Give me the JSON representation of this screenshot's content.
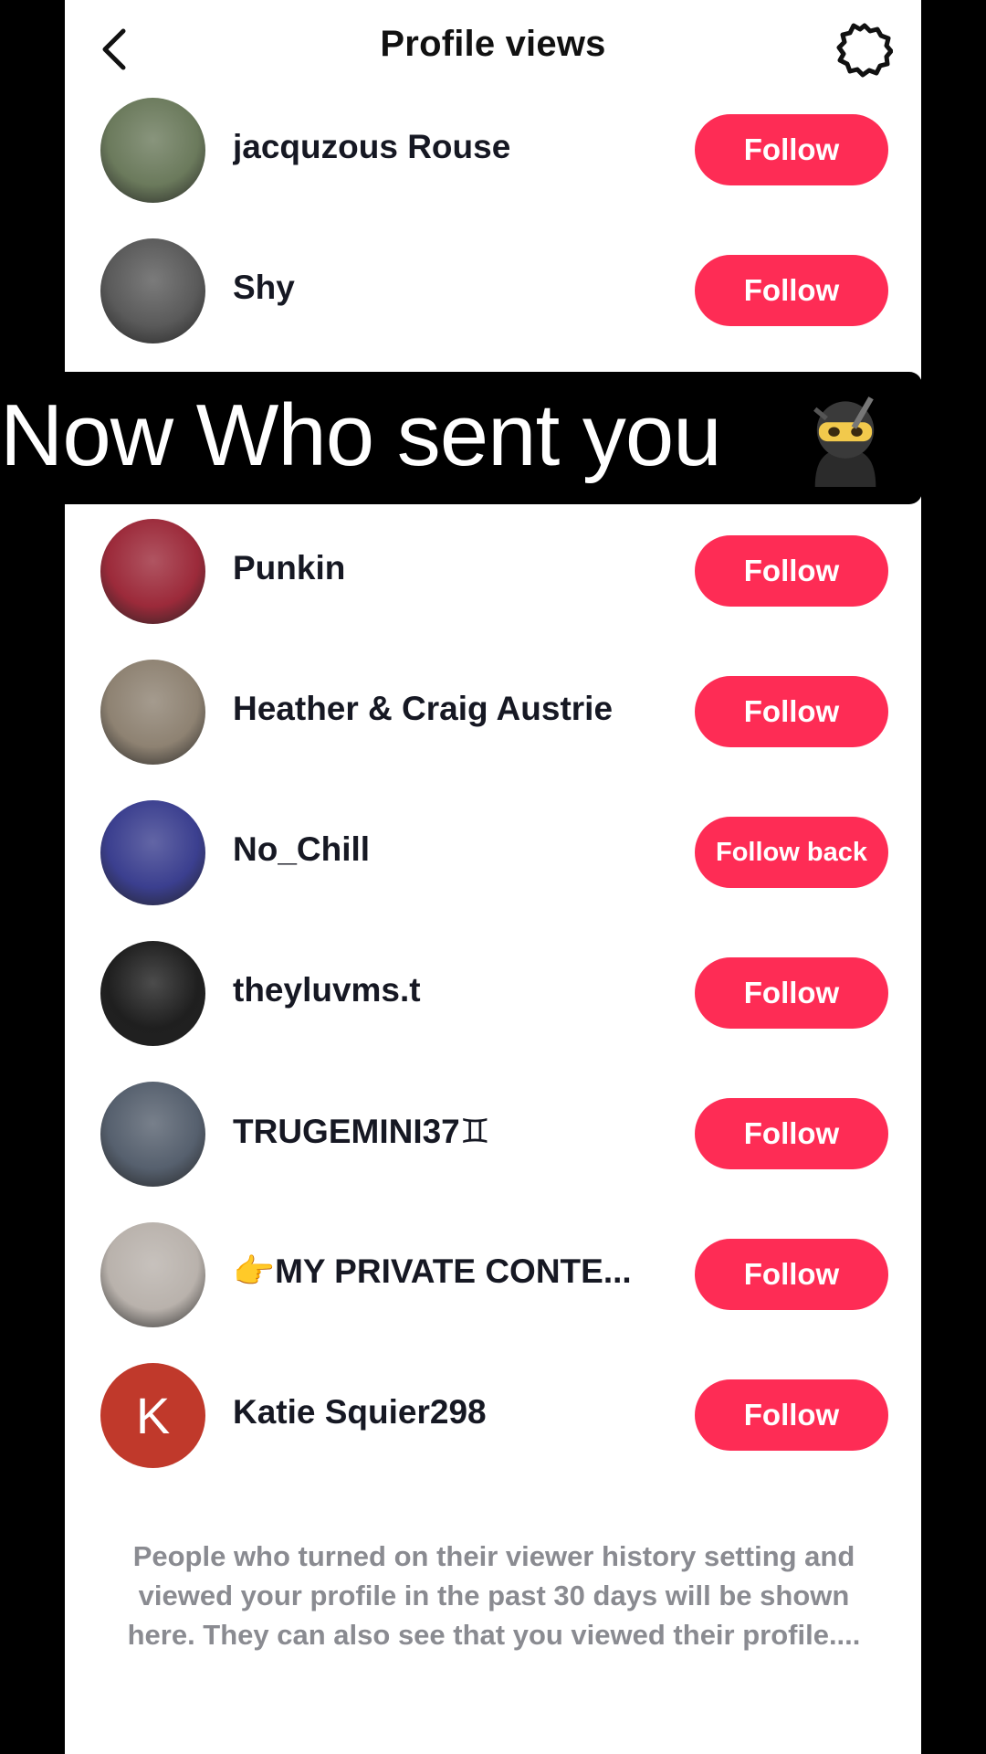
{
  "header": {
    "title": "Profile views",
    "back_icon": "chevron-left-icon",
    "settings_icon": "gear-icon"
  },
  "overlay": {
    "text": "Now Who sent you",
    "emoji": "ninja"
  },
  "viewers": [
    {
      "name": "jacquzous Rouse",
      "button": "Follow",
      "avatar_color": "#6b7a5c"
    },
    {
      "name": "Shy",
      "button": "Follow",
      "avatar_color": "#5a5a5a"
    },
    {
      "name": "Punkin",
      "button": "Follow",
      "avatar_color": "#9c2a3a"
    },
    {
      "name": "Heather & Craig Austrie",
      "button": "Follow",
      "avatar_color": "#8e8272"
    },
    {
      "name": "No_Chill",
      "button": "Follow back",
      "avatar_color": "#3b3f8f"
    },
    {
      "name": "theyluvms.t",
      "button": "Follow",
      "avatar_color": "#1f1f1f"
    },
    {
      "name": "TRUGEMINI37♊",
      "button": "Follow",
      "avatar_color": "#56606e"
    },
    {
      "name": "👉MY PRIVATE CONTE...",
      "button": "Follow",
      "avatar_color": "#b9b2ac"
    },
    {
      "name": "Katie Squier298",
      "button": "Follow",
      "avatar_color": "#c0392b",
      "avatar_letter": "K"
    }
  ],
  "footer": {
    "text": "People who turned on their viewer history setting and viewed your profile in the past 30 days will be shown here. They can also see that you viewed their profile...."
  },
  "colors": {
    "accent": "#FE2C55",
    "background": "#000000",
    "panel": "#FFFFFF"
  }
}
